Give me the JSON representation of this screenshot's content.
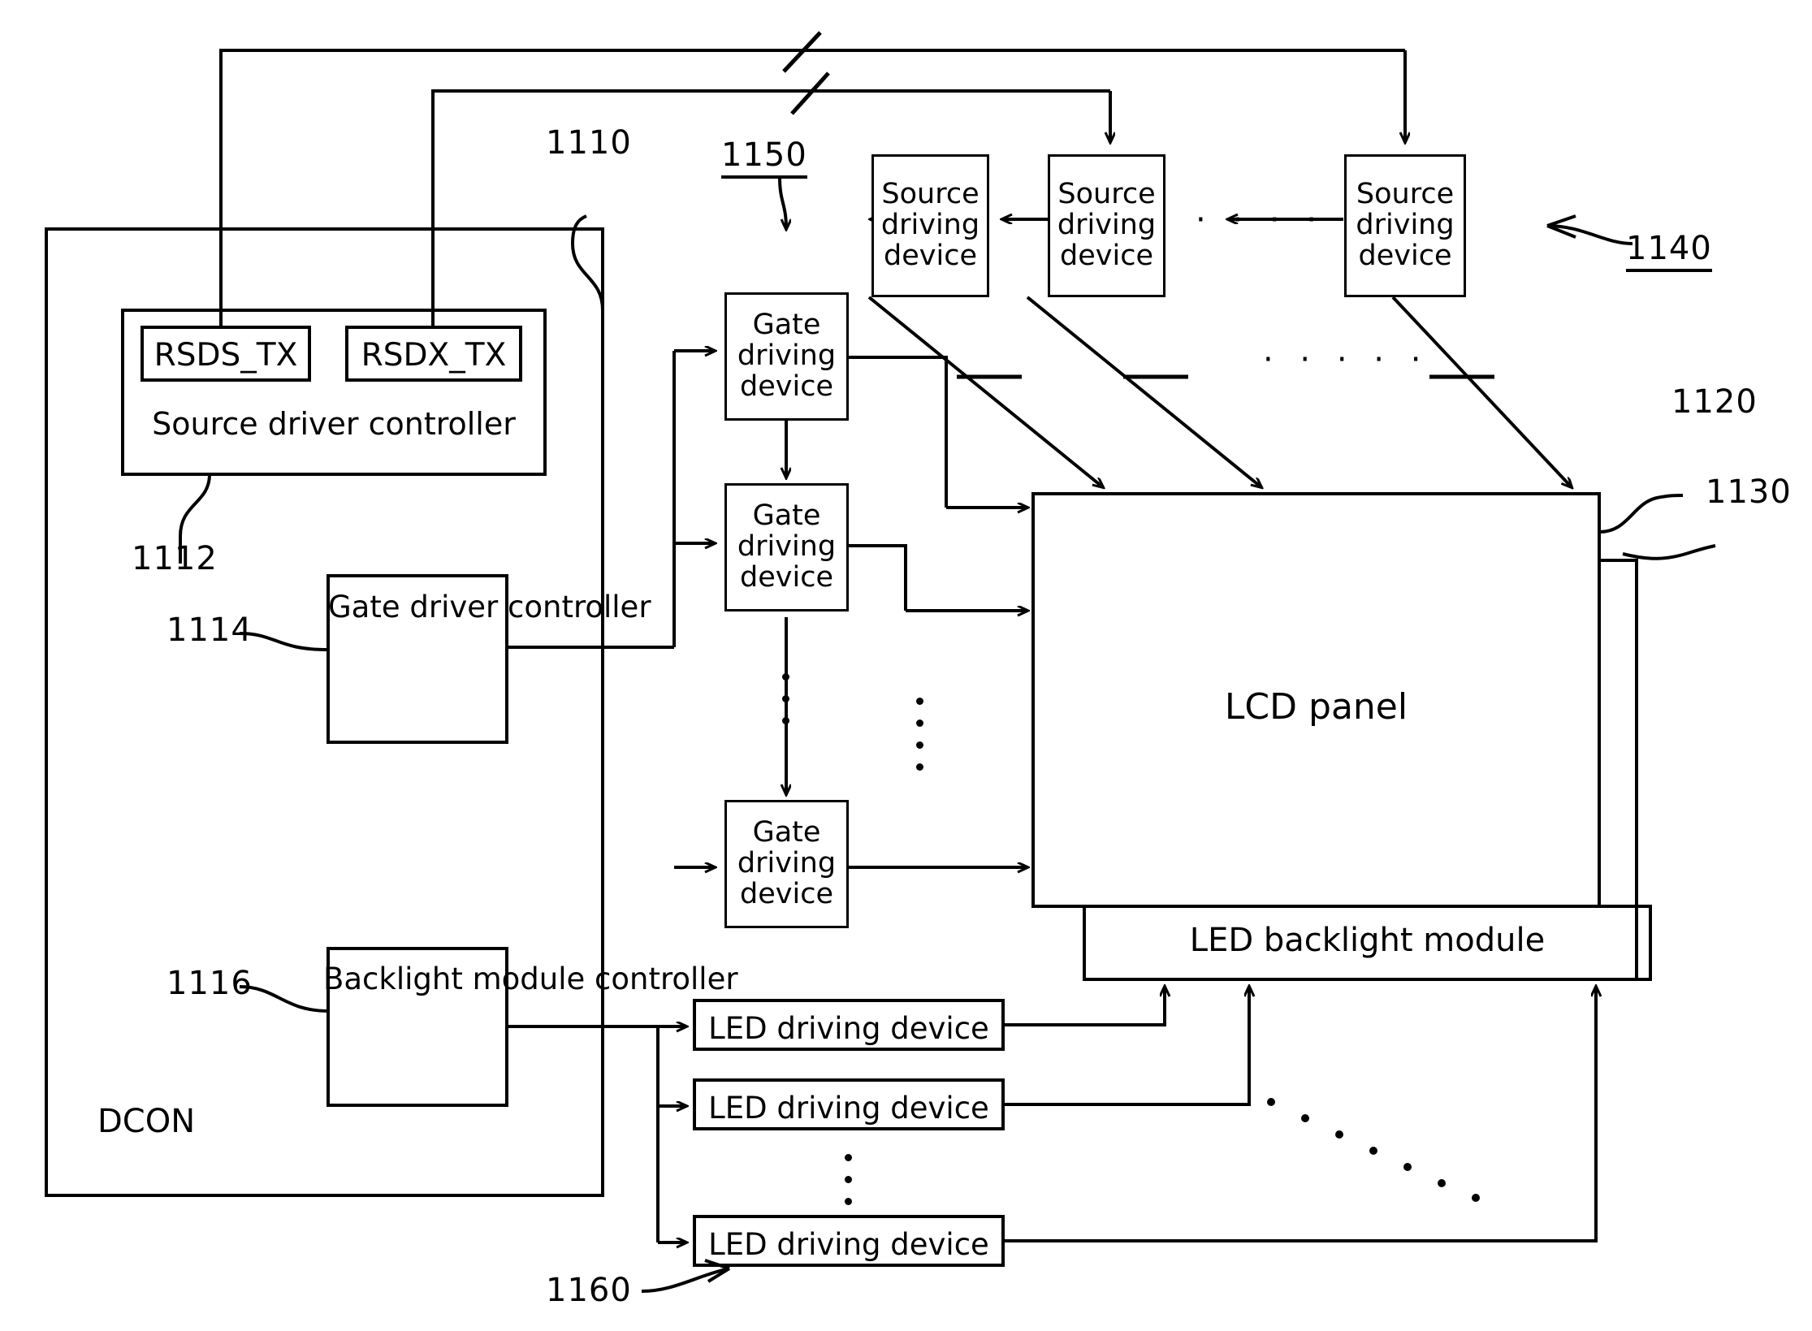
{
  "figure": {
    "title": "LCD display driving architecture block diagram",
    "dcon_label": "DCON"
  },
  "blocks": {
    "rsds_tx": "RSDS_TX",
    "rsdx_tx": "RSDX_TX",
    "source_driver_controller": "Source  driver  controller",
    "gate_driver_controller": [
      "Gate",
      "driver",
      "controller"
    ],
    "backlight_module_controller": [
      "Backlight",
      "module",
      "controller"
    ],
    "gate_driving_device": [
      "Gate",
      "driving",
      "device"
    ],
    "source_driving_device": [
      "Source",
      "driving",
      "device"
    ],
    "led_driving_device": "LED driving  device",
    "lcd_panel": "LCD panel",
    "led_backlight_module": "LED backlight  module"
  },
  "gate_driving_devices": [
    {
      "lines": [
        "Gate",
        "driving",
        "device"
      ]
    },
    {
      "lines": [
        "Gate",
        "driving",
        "device"
      ]
    },
    {
      "lines": [
        "Gate",
        "driving",
        "device"
      ]
    }
  ],
  "source_driving_devices": [
    {
      "lines": [
        "Source",
        "driving",
        "device"
      ]
    },
    {
      "lines": [
        "Source",
        "driving",
        "device"
      ]
    },
    {
      "lines": [
        "Source",
        "driving",
        "device"
      ]
    }
  ],
  "led_driving_devices": [
    {
      "label": "LED driving  device"
    },
    {
      "label": "LED driving  device"
    },
    {
      "label": "LED driving  device"
    }
  ],
  "reference_numerals": {
    "n1110": "1110",
    "n1112": "1112",
    "n1114": "1114",
    "n1116": "1116",
    "n1120": "1120",
    "n1130": "1130",
    "n1140": "1140",
    "n1150": "1150",
    "n1160": "1160"
  },
  "ellipses": {
    "source_row": "· · · ·",
    "under_source_row": "· · · · ·"
  },
  "colors": {
    "stroke": "#000000",
    "background": "#ffffff"
  }
}
